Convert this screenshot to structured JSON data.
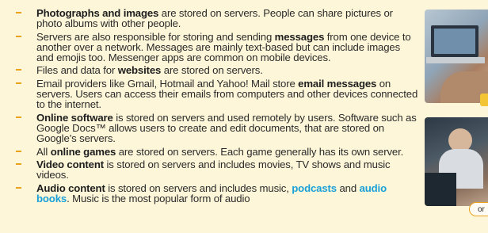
{
  "bullets": [
    {
      "pre": "",
      "bold": "Photographs and images",
      "post": " are stored on servers. People can share pictures or photo albums with other people."
    },
    {
      "pre": "Servers are also responsible for storing and sending ",
      "bold": "messages",
      "post": " from one device to another over a network. Messages are mainly text-based but can include images and emojis too. Messenger apps are common on mobile devices."
    },
    {
      "pre": "Files and data for ",
      "bold": "websites",
      "post": " are stored on servers."
    },
    {
      "pre": "Email providers like Gmail, Hotmail and Yahoo! Mail store ",
      "bold": "email messages",
      "post": " on servers. Users can access their emails from computers and other devices connected to the internet."
    },
    {
      "pre": "",
      "bold": "Online software",
      "post": " is stored on servers and used remotely by users. Software such as Google Docs™ allows users to create and edit documents, that are stored on Google’s servers."
    },
    {
      "pre": "All ",
      "bold": "online games",
      "post": " are stored on servers. Each game generally has its own server."
    },
    {
      "pre": "",
      "bold": "Video content",
      "post": " is stored on servers and includes movies, TV shows and music videos."
    }
  ],
  "last_bullet": {
    "bold": "Audio content",
    "mid": " is stored on servers and includes music, ",
    "link1": "podcasts",
    "and": " and ",
    "link2": "audio books",
    "post": ". Music is the most popular form of audio"
  },
  "caption_text": "or",
  "colors": {
    "bullet": "#e9a21a",
    "link": "#1aa0d8",
    "background": "#fdf6d8"
  },
  "icons": {
    "photo_1": "laptop-photo",
    "photo_2": "person-at-computer-photo"
  }
}
